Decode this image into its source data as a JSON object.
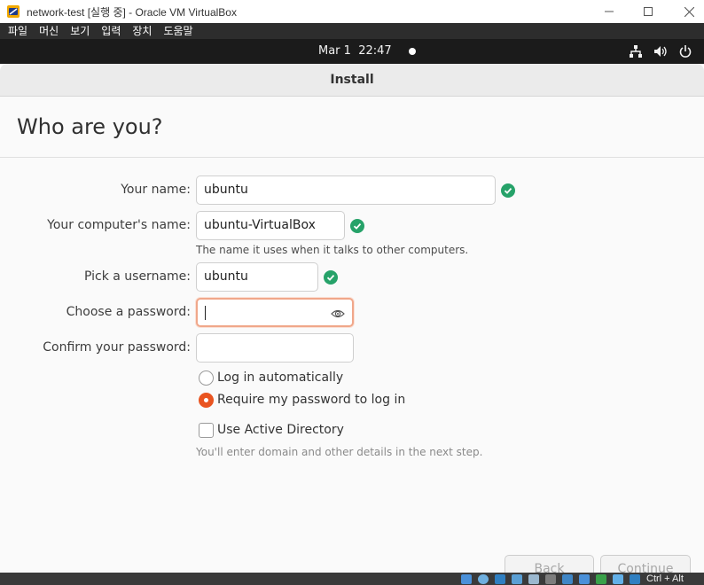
{
  "window": {
    "title": "network-test [실행 중] - Oracle VM VirtualBox"
  },
  "menu": [
    "파일",
    "머신",
    "보기",
    "입력",
    "장치",
    "도움말"
  ],
  "topbar": {
    "date": "Mar 1",
    "time": "22:47"
  },
  "installer": {
    "title": "Install",
    "heading": "Who are you?",
    "fields": {
      "name": {
        "label": "Your name:",
        "value": "ubuntu",
        "valid": true
      },
      "computer": {
        "label": "Your computer's name:",
        "value": "ubuntu-VirtualBox",
        "valid": true,
        "hint": "The name it uses when it talks to other computers."
      },
      "username": {
        "label": "Pick a username:",
        "value": "ubuntu",
        "valid": true
      },
      "password": {
        "label": "Choose a password:",
        "value": ""
      },
      "confirm": {
        "label": "Confirm your password:",
        "value": ""
      }
    },
    "login_options": [
      {
        "label": "Log in automatically",
        "selected": false
      },
      {
        "label": "Require my password to log in",
        "selected": true
      }
    ],
    "active_directory": {
      "label": "Use Active Directory",
      "checked": false,
      "hint": "You'll enter domain and other details in the next step."
    },
    "buttons": {
      "back": "Back",
      "continue": "Continue"
    }
  },
  "statusbar": {
    "host_key": "Ctrl + Alt"
  },
  "colors": {
    "accent": "#e95420",
    "valid_check": "#26a269",
    "topbar": "#1b1b1b",
    "menubar": "#2d2d2d"
  }
}
